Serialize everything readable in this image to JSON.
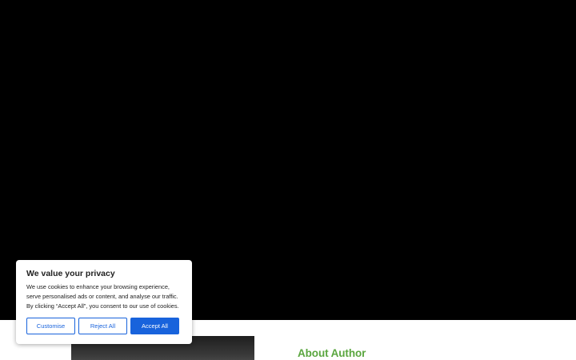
{
  "author": {
    "heading": "About Author"
  },
  "cookie_banner": {
    "title": "We value your privacy",
    "description": "We use cookies to enhance your browsing experience, serve personalised ads or content, and analyse our traffic. By clicking “Accept All”, you consent to our use of cookies.",
    "buttons": {
      "customise": "Customise",
      "reject": "Reject All",
      "accept": "Accept All"
    },
    "accent_color": "#1863dc"
  },
  "colors": {
    "hero_background": "#000000",
    "author_heading": "#5aa63f"
  }
}
